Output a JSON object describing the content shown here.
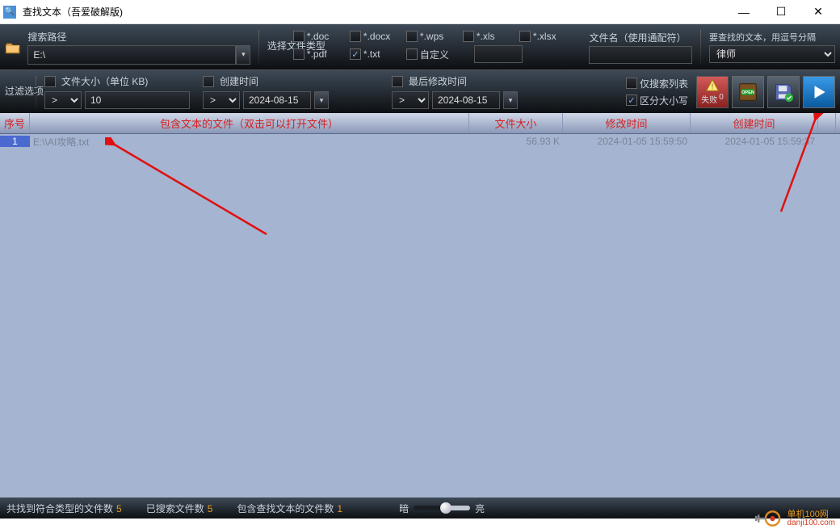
{
  "window": {
    "title": "查找文本（吾爱破解版)"
  },
  "pathSection": {
    "label": "搜索路径",
    "value": "E:\\"
  },
  "fileTypes": {
    "label": "选择文件类型",
    "items": [
      {
        "label": "*.doc",
        "checked": false
      },
      {
        "label": "*.docx",
        "checked": false
      },
      {
        "label": "*.wps",
        "checked": false
      },
      {
        "label": "*.xls",
        "checked": false
      },
      {
        "label": "*.xlsx",
        "checked": false
      },
      {
        "label": "*.pdf",
        "checked": false
      },
      {
        "label": "*.txt",
        "checked": true
      },
      {
        "label": "自定义",
        "checked": false
      }
    ],
    "customValue": ""
  },
  "filename": {
    "label": "文件名（使用通配符）",
    "value": ""
  },
  "searchText": {
    "label": "要查找的文本，用逗号分隔",
    "value": "律师"
  },
  "filter": {
    "label": "过滤选项",
    "size": {
      "label": "文件大小（单位 KB)",
      "op": ">",
      "value": "10"
    },
    "created": {
      "label": "创建时间",
      "op": ">",
      "value": "2024-08-15"
    },
    "modified": {
      "label": "最后修改时间",
      "op": ">",
      "value": "2024-08-15"
    },
    "listOnly": {
      "label": "仅搜索列表",
      "checked": false
    },
    "caseSensitive": {
      "label": "区分大小写",
      "checked": true
    },
    "failBtn": {
      "label": "失败",
      "count": "0"
    }
  },
  "table": {
    "headers": {
      "idx": "序号",
      "file": "包含文本的文件（双击可以打开文件）",
      "size": "文件大小",
      "mod": "修改时间",
      "create": "创建时间"
    },
    "rows": [
      {
        "idx": "1",
        "file": "E:\\\\AI攻略.txt",
        "size": "56.93 K",
        "mod": "2024-01-05 15:59:50",
        "create": "2024-01-05 15:59:37"
      }
    ]
  },
  "status": {
    "matchedLabel": "共找到符合类型的文件数",
    "matchedCount": "5",
    "searchedLabel": "已搜索文件数",
    "searchedCount": "5",
    "containLabel": "包含查找文本的文件数",
    "containCount": "1",
    "dark": "暗",
    "light": "亮"
  },
  "watermark": {
    "line1": "单机100网",
    "line2": "danji100.com"
  }
}
